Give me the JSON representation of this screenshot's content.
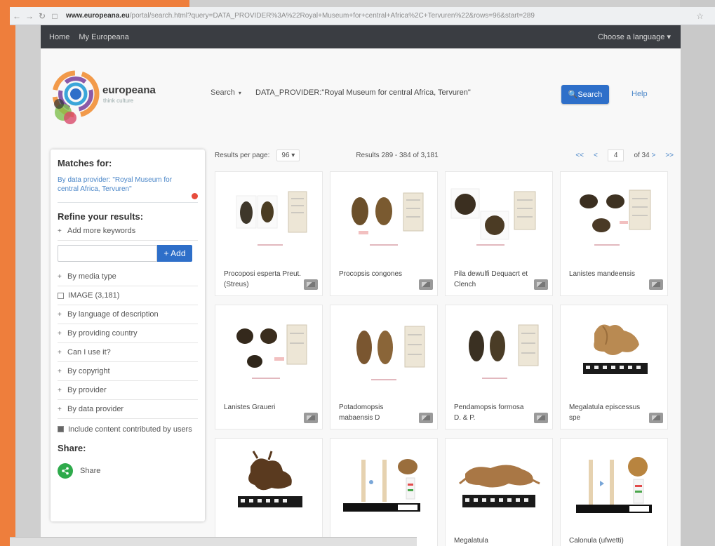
{
  "browser": {
    "url_prefix": "www.europeana.eu",
    "url_rest": "/portal/search.html?query=DATA_PROVIDER%3A%22Royal+Museum+for+central+Africa%2C+Tervuren%22&rows=96&start=289"
  },
  "topnav": {
    "home": "Home",
    "my_europeana": "My Europeana",
    "language": "Choose a language"
  },
  "header": {
    "brand": "europeana",
    "brand_sub": "think culture",
    "search_label": "Search",
    "search_value": "DATA_PROVIDER:\"Royal Museum for central Africa, Tervuren\"",
    "search_button": "Search",
    "help": "Help"
  },
  "sidebar": {
    "matches_heading": "Matches for:",
    "match_text": "By data provider: \"Royal Museum for central Africa, Tervuren\"",
    "refine_heading": "Refine your results:",
    "add_keywords": "Add more keywords",
    "add_button": "+ Add",
    "facets": [
      {
        "label": "By media type",
        "expand": "+"
      },
      {
        "label": "IMAGE (3,181)",
        "expand": "checkbox"
      },
      {
        "label": "By language of description",
        "expand": "+"
      },
      {
        "label": "By providing country",
        "expand": "+"
      },
      {
        "label": "Can I use it?",
        "expand": "+"
      },
      {
        "label": "By copyright",
        "expand": "+"
      },
      {
        "label": "By provider",
        "expand": "+"
      },
      {
        "label": "By data provider",
        "expand": "+"
      }
    ],
    "ugc_text": "Include content contributed by users",
    "share_heading": "Share:",
    "share_label": "Share"
  },
  "results": {
    "per_page_label": "Results per page:",
    "per_page_value": "96",
    "count": "Results 289 - 384 of 3,181",
    "first": "<<",
    "prev": "<",
    "page": "4",
    "of_pages": "of 34",
    "next": ">",
    "last": ">>"
  },
  "items": [
    {
      "title": "Procoposi esperta Preut. (Streus)"
    },
    {
      "title": "Procopsis congones"
    },
    {
      "title": "Pila dewulfi Dequacrt et Clench"
    },
    {
      "title": "Lanistes mandeensis"
    },
    {
      "title": "Lanistes Graueri"
    },
    {
      "title": "Potadomopsis mabaensis D"
    },
    {
      "title": "Pendamopsis formosa D. & P."
    },
    {
      "title": "Megalatula episcessus spe"
    },
    {
      "title": ""
    },
    {
      "title": ""
    },
    {
      "title": "Megalatula"
    },
    {
      "title": "Calonula (ufwetti)"
    }
  ]
}
